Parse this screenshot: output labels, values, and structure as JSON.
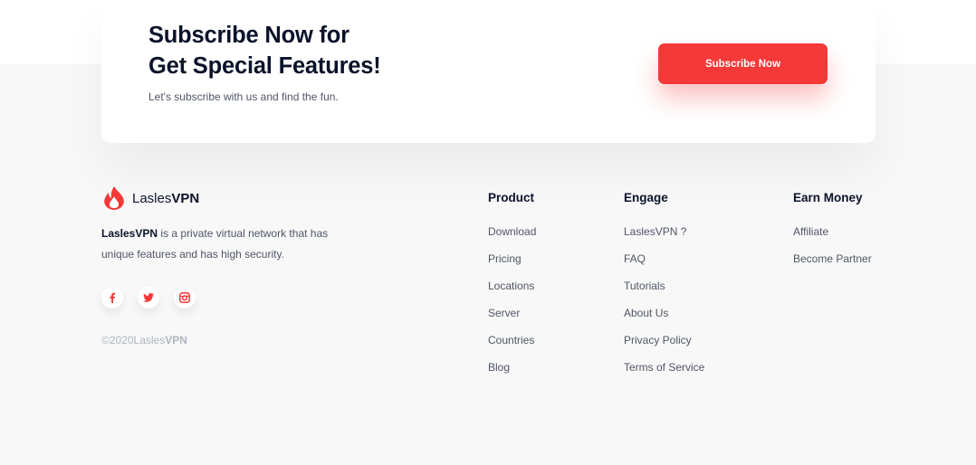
{
  "subscribe": {
    "title_line1": "Subscribe Now for",
    "title_line2": "Get Special Features!",
    "description": "Let's subscribe with us and find the fun.",
    "button_label": "Subscribe Now"
  },
  "brand": {
    "name_light": "Lasles",
    "name_bold": "VPN",
    "desc_bold": "LaslesVPN",
    "desc_rest": " is a private virtual network that has unique features and has high security.",
    "socials": [
      "facebook-icon",
      "twitter-icon",
      "instagram-icon"
    ],
    "copyright_light": "©2020Lasles",
    "copyright_bold": "VPN"
  },
  "footer": {
    "product": {
      "title": "Product",
      "links": [
        "Download",
        "Pricing",
        "Locations",
        "Server",
        "Countries",
        "Blog"
      ]
    },
    "engage": {
      "title": "Engage",
      "links": [
        "LaslesVPN ?",
        "FAQ",
        "Tutorials",
        "About Us",
        "Privacy Policy",
        "Terms of Service"
      ]
    },
    "earn": {
      "title": "Earn Money",
      "links": [
        "Affiliate",
        "Become Partner"
      ]
    }
  },
  "colors": {
    "accent": "#F53838",
    "text_dark": "#0B132A",
    "text_muted": "#4F5665",
    "footer_bg": "#F8F8F8"
  }
}
